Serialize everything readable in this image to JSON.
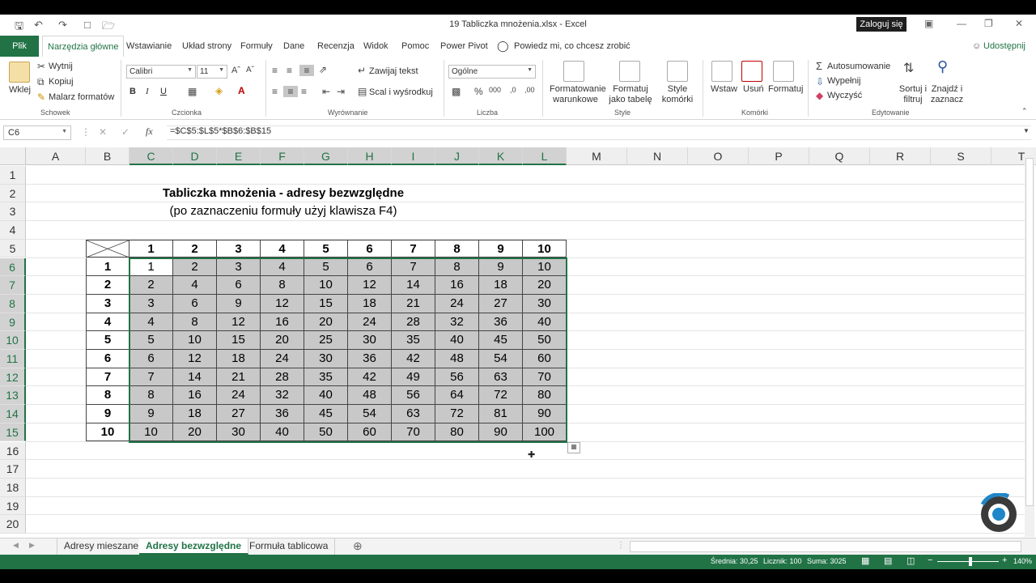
{
  "window": {
    "title": "19 Tabliczka mnożenia.xlsx  -  Excel",
    "signin": "Zaloguj się"
  },
  "tabs": [
    "Plik",
    "Narzędzia główne",
    "Wstawianie",
    "Układ strony",
    "Formuły",
    "Dane",
    "Recenzja",
    "Widok",
    "Pomoc",
    "Power Pivot"
  ],
  "tell_me": "Powiedz mi, co chcesz zrobić",
  "share": "Udostępnij",
  "ribbon": {
    "clipboard": {
      "paste": "Wklej",
      "cut": "Wytnij",
      "copy": "Kopiuj",
      "painter": "Malarz formatów",
      "label": "Schowek"
    },
    "font": {
      "name": "Calibri",
      "size": "11",
      "bold": "B",
      "italic": "I",
      "underline": "U",
      "label": "Czcionka"
    },
    "alignment": {
      "wrap": "Zawijaj tekst",
      "merge": "Scal i wyśrodkuj",
      "label": "Wyrównanie"
    },
    "number": {
      "format": "Ogólne",
      "label": "Liczba"
    },
    "styles": {
      "cond": "Formatowanie warunkowe",
      "table": "Formatuj jako tabelę",
      "cell": "Style komórki",
      "label": "Style"
    },
    "cells": {
      "insert": "Wstaw",
      "delete": "Usuń",
      "format": "Formatuj",
      "label": "Komórki"
    },
    "editing": {
      "autosum": "Autosumowanie",
      "fill": "Wypełnij",
      "clear": "Wyczyść",
      "sort": "Sortuj i filtruj",
      "find": "Znajdź i zaznacz",
      "label": "Edytowanie"
    }
  },
  "formula_bar": {
    "name_box": "C6",
    "fx": "fx",
    "formula": "=$C$5:$L$5*$B$6:$B$15"
  },
  "columns": [
    "A",
    "B",
    "C",
    "D",
    "E",
    "F",
    "G",
    "H",
    "I",
    "J",
    "K",
    "L",
    "M",
    "N",
    "O",
    "P",
    "Q",
    "R",
    "S",
    "T"
  ],
  "rows": [
    "1",
    "2",
    "3",
    "4",
    "5",
    "6",
    "7",
    "8",
    "9",
    "10",
    "11",
    "12",
    "13",
    "14",
    "15",
    "16",
    "17",
    "18",
    "19",
    "20"
  ],
  "sheet": {
    "title": "Tabliczka mnożenia - adresy bezwzględne",
    "subtitle": "(po zaznaczeniu formuły użyj klawisza F4)",
    "header_row": [
      "1",
      "2",
      "3",
      "4",
      "5",
      "6",
      "7",
      "8",
      "9",
      "10"
    ],
    "header_col": [
      "1",
      "2",
      "3",
      "4",
      "5",
      "6",
      "7",
      "8",
      "9",
      "10"
    ],
    "values": [
      [
        "1",
        "2",
        "3",
        "4",
        "5",
        "6",
        "7",
        "8",
        "9",
        "10"
      ],
      [
        "2",
        "4",
        "6",
        "8",
        "10",
        "12",
        "14",
        "16",
        "18",
        "20"
      ],
      [
        "3",
        "6",
        "9",
        "12",
        "15",
        "18",
        "21",
        "24",
        "27",
        "30"
      ],
      [
        "4",
        "8",
        "12",
        "16",
        "20",
        "24",
        "28",
        "32",
        "36",
        "40"
      ],
      [
        "5",
        "10",
        "15",
        "20",
        "25",
        "30",
        "35",
        "40",
        "45",
        "50"
      ],
      [
        "6",
        "12",
        "18",
        "24",
        "30",
        "36",
        "42",
        "48",
        "54",
        "60"
      ],
      [
        "7",
        "14",
        "21",
        "28",
        "35",
        "42",
        "49",
        "56",
        "63",
        "70"
      ],
      [
        "8",
        "16",
        "24",
        "32",
        "40",
        "48",
        "56",
        "64",
        "72",
        "80"
      ],
      [
        "9",
        "18",
        "27",
        "36",
        "45",
        "54",
        "63",
        "72",
        "81",
        "90"
      ],
      [
        "10",
        "20",
        "30",
        "40",
        "50",
        "60",
        "70",
        "80",
        "90",
        "100"
      ]
    ]
  },
  "sheet_tabs": [
    "Adresy mieszane",
    "Adresy bezwzględne",
    "Formuła tablicowa"
  ],
  "active_sheet": "Adresy bezwzględne",
  "status": {
    "average": "Średnia: 30,25",
    "count": "Licznik: 100",
    "sum": "Suma: 3025",
    "zoom": "140%"
  },
  "colors": {
    "accent": "#217346",
    "selection_fill": "#c8c8c8"
  }
}
